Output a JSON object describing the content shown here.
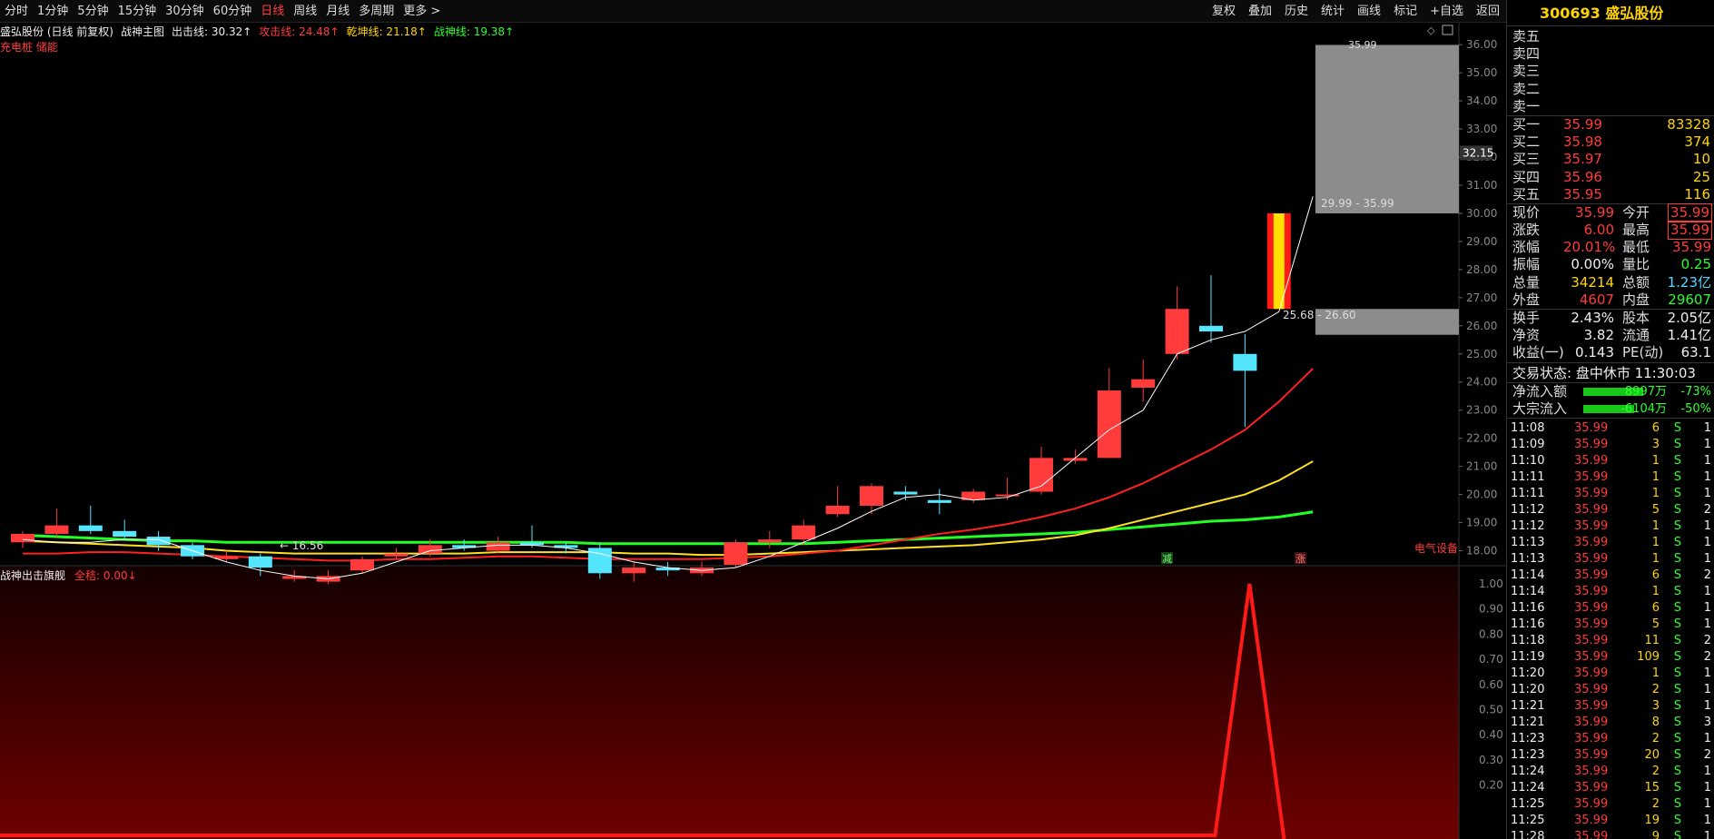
{
  "toolbar": {
    "periods": [
      "分时",
      "1分钟",
      "5分钟",
      "15分钟",
      "30分钟",
      "60分钟",
      "日线",
      "周线",
      "月线",
      "多周期",
      "更多 >"
    ],
    "active_period": "日线",
    "right_items": [
      "复权",
      "叠加",
      "历史",
      "统计",
      "画线",
      "标记",
      "+自选",
      "返回"
    ]
  },
  "legend": {
    "stock": "盛弘股份 (日线 前复权)",
    "indicator": "战神主图",
    "chuji": "出击线: 30.32↑",
    "gongji": "攻击线: 24.48↑",
    "qiankun": "乾坤线: 21.18↑",
    "zhanshen": "战神线: 19.38↑",
    "sub": "充电桩 储能"
  },
  "sub_legend": {
    "name": "战神出击旗舰",
    "value": "全秸: 0.00↓"
  },
  "colors": {
    "up": "#ff3b3b",
    "down": "#55e6ff",
    "ma_gongji": "#ff2020",
    "ma_qiankun": "#ffe020",
    "ma_zhanshen": "#22ff22",
    "price_line": "#ffffff"
  },
  "chart_data": {
    "type": "candlestick",
    "y_axis_ticks": [
      "36.00",
      "35.00",
      "34.00",
      "33.00",
      "32.00",
      "31.00",
      "30.00",
      "29.00",
      "28.00",
      "27.00",
      "26.00",
      "25.00",
      "24.00",
      "23.00",
      "22.00",
      "21.00",
      "20.00",
      "19.00",
      "18.00"
    ],
    "ylim": [
      17.5,
      36.2
    ],
    "current_price_marker": "32.15",
    "sub_axis_ticks": [
      "1.00",
      "0.90",
      "0.80",
      "0.70",
      "0.60",
      "0.50",
      "0.40",
      "0.30",
      "0.20"
    ],
    "candles": [
      {
        "o": 18.3,
        "c": 18.6,
        "h": 18.7,
        "l": 18.1
      },
      {
        "o": 18.6,
        "c": 18.9,
        "h": 19.5,
        "l": 18.5
      },
      {
        "o": 18.9,
        "c": 18.7,
        "h": 19.6,
        "l": 18.6
      },
      {
        "o": 18.7,
        "c": 18.5,
        "h": 19.1,
        "l": 18.4
      },
      {
        "o": 18.5,
        "c": 18.2,
        "h": 18.7,
        "l": 18.0
      },
      {
        "o": 18.2,
        "c": 17.8,
        "h": 18.3,
        "l": 17.7
      },
      {
        "o": 17.7,
        "c": 17.8,
        "h": 18.0,
        "l": 17.6
      },
      {
        "o": 17.8,
        "c": 17.4,
        "h": 17.9,
        "l": 17.1
      },
      {
        "o": 17.0,
        "c": 17.1,
        "h": 17.3,
        "l": 16.9
      },
      {
        "o": 16.9,
        "c": 17.1,
        "h": 17.3,
        "l": 16.8
      },
      {
        "o": 17.3,
        "c": 17.7,
        "h": 17.8,
        "l": 17.2
      },
      {
        "o": 17.8,
        "c": 17.9,
        "h": 18.1,
        "l": 17.7
      },
      {
        "o": 17.9,
        "c": 18.2,
        "h": 18.4,
        "l": 17.8
      },
      {
        "o": 18.2,
        "c": 18.1,
        "h": 18.4,
        "l": 18.0
      },
      {
        "o": 18.0,
        "c": 18.3,
        "h": 18.5,
        "l": 17.9
      },
      {
        "o": 18.3,
        "c": 18.2,
        "h": 18.9,
        "l": 18.1
      },
      {
        "o": 18.2,
        "c": 18.1,
        "h": 18.3,
        "l": 17.9
      },
      {
        "o": 18.1,
        "c": 17.2,
        "h": 18.3,
        "l": 17.0
      },
      {
        "o": 17.2,
        "c": 17.4,
        "h": 17.6,
        "l": 16.9
      },
      {
        "o": 17.4,
        "c": 17.3,
        "h": 17.6,
        "l": 17.1
      },
      {
        "o": 17.2,
        "c": 17.4,
        "h": 17.6,
        "l": 17.1
      },
      {
        "o": 17.5,
        "c": 18.3,
        "h": 18.4,
        "l": 17.4
      },
      {
        "o": 18.3,
        "c": 18.4,
        "h": 18.7,
        "l": 18.1
      },
      {
        "o": 18.4,
        "c": 18.9,
        "h": 19.1,
        "l": 18.2
      },
      {
        "o": 19.3,
        "c": 19.6,
        "h": 20.3,
        "l": 19.2
      },
      {
        "o": 19.6,
        "c": 20.3,
        "h": 20.4,
        "l": 19.3
      },
      {
        "o": 20.1,
        "c": 20.0,
        "h": 20.3,
        "l": 19.8
      },
      {
        "o": 19.8,
        "c": 19.7,
        "h": 20.2,
        "l": 19.3
      },
      {
        "o": 19.8,
        "c": 20.1,
        "h": 20.2,
        "l": 19.7
      },
      {
        "o": 20.0,
        "c": 20.0,
        "h": 20.6,
        "l": 19.8
      },
      {
        "o": 20.1,
        "c": 21.3,
        "h": 21.7,
        "l": 20.0
      },
      {
        "o": 21.2,
        "c": 21.3,
        "h": 21.6,
        "l": 21.1
      },
      {
        "o": 21.3,
        "c": 23.7,
        "h": 24.5,
        "l": 21.3
      },
      {
        "o": 23.8,
        "c": 24.1,
        "h": 24.8,
        "l": 23.3
      },
      {
        "o": 25.0,
        "c": 26.6,
        "h": 27.4,
        "l": 24.8
      },
      {
        "o": 26.0,
        "c": 25.8,
        "h": 27.8,
        "l": 25.4
      },
      {
        "o": 25.0,
        "c": 24.4,
        "h": 25.7,
        "l": 22.4
      },
      {
        "o": 26.6,
        "c": 30.0,
        "h": 30.0,
        "l": 26.6
      }
    ],
    "ma_gongji": [
      17.9,
      17.9,
      17.95,
      17.95,
      17.9,
      17.85,
      17.8,
      17.75,
      17.7,
      17.65,
      17.65,
      17.7,
      17.7,
      17.75,
      17.8,
      17.8,
      17.75,
      17.7,
      17.7,
      17.7,
      17.7,
      17.75,
      17.8,
      17.9,
      18.0,
      18.2,
      18.4,
      18.6,
      18.75,
      18.95,
      19.2,
      19.5,
      19.9,
      20.4,
      21.0,
      21.6,
      22.3,
      23.3,
      24.48
    ],
    "ma_qiankun": [
      18.35,
      18.3,
      18.25,
      18.2,
      18.15,
      18.1,
      18.0,
      17.95,
      17.9,
      17.9,
      17.9,
      17.9,
      17.9,
      17.9,
      17.95,
      17.95,
      17.95,
      17.95,
      17.9,
      17.9,
      17.85,
      17.85,
      17.9,
      17.95,
      18.0,
      18.05,
      18.1,
      18.15,
      18.2,
      18.3,
      18.4,
      18.55,
      18.8,
      19.1,
      19.4,
      19.7,
      20.0,
      20.5,
      21.18
    ],
    "ma_zhanshen": [
      18.55,
      18.5,
      18.45,
      18.4,
      18.35,
      18.35,
      18.3,
      18.3,
      18.3,
      18.3,
      18.3,
      18.3,
      18.3,
      18.3,
      18.3,
      18.3,
      18.3,
      18.25,
      18.25,
      18.25,
      18.25,
      18.25,
      18.25,
      18.25,
      18.3,
      18.35,
      18.4,
      18.45,
      18.5,
      18.55,
      18.6,
      18.65,
      18.75,
      18.85,
      18.95,
      19.05,
      19.1,
      19.2,
      19.38
    ],
    "price_line": [
      18.4,
      18.3,
      18.3,
      18.4,
      18.4,
      18.0,
      17.6,
      17.3,
      17.1,
      17.0,
      17.2,
      17.6,
      18.0,
      18.1,
      18.2,
      18.2,
      18.1,
      17.9,
      17.6,
      17.4,
      17.3,
      17.4,
      17.8,
      18.3,
      18.8,
      19.4,
      19.9,
      20.0,
      19.8,
      19.9,
      20.3,
      21.3,
      22.3,
      23.0,
      25.0,
      25.5,
      25.8,
      26.5,
      30.6
    ],
    "annotations": {
      "low": "16.56",
      "zone_top": "29.99 - 35.99",
      "zone_bottom": "25.68 - 26.60",
      "high": "35.99",
      "sector": "电气设备",
      "tag_jian": "减",
      "tag_zhang": "涨"
    }
  },
  "quote": {
    "code": "300693",
    "name": "盛弘股份",
    "sell": [
      {
        "label": "卖五",
        "price": "",
        "vol": ""
      },
      {
        "label": "卖四",
        "price": "",
        "vol": ""
      },
      {
        "label": "卖三",
        "price": "",
        "vol": ""
      },
      {
        "label": "卖二",
        "price": "",
        "vol": ""
      },
      {
        "label": "卖一",
        "price": "",
        "vol": ""
      }
    ],
    "buy": [
      {
        "label": "买一",
        "price": "35.99",
        "vol": "83328"
      },
      {
        "label": "买二",
        "price": "35.98",
        "vol": "374"
      },
      {
        "label": "买三",
        "price": "35.97",
        "vol": "10"
      },
      {
        "label": "买四",
        "price": "35.96",
        "vol": "25"
      },
      {
        "label": "买五",
        "price": "35.95",
        "vol": "116"
      }
    ],
    "stats1": [
      {
        "l1": "现价",
        "v1": "35.99",
        "c1": "red",
        "l2": "今开",
        "v2": "35.99",
        "c2": "red",
        "b2": true
      },
      {
        "l1": "涨跌",
        "v1": "6.00",
        "c1": "red",
        "l2": "最高",
        "v2": "35.99",
        "c2": "red",
        "b2": true
      },
      {
        "l1": "涨幅",
        "v1": "20.01%",
        "c1": "red",
        "l2": "最低",
        "v2": "35.99",
        "c2": "red",
        "b2": false
      },
      {
        "l1": "振幅",
        "v1": "0.00%",
        "c1": "white",
        "l2": "量比",
        "v2": "0.25",
        "c2": "green",
        "b2": false
      },
      {
        "l1": "总量",
        "v1": "34214",
        "c1": "yellow",
        "l2": "总额",
        "v2": "1.23亿",
        "c2": "cyan",
        "b2": false
      },
      {
        "l1": "外盘",
        "v1": "4607",
        "c1": "red",
        "l2": "内盘",
        "v2": "29607",
        "c2": "green",
        "b2": false
      }
    ],
    "stats2": [
      {
        "l1": "换手",
        "v1": "2.43%",
        "l2": "股本",
        "v2": "2.05亿"
      },
      {
        "l1": "净资",
        "v1": "3.82",
        "l2": "流通",
        "v2": "1.41亿"
      },
      {
        "l1": "收益(一)",
        "v1": "0.143",
        "l2": "PE(动)",
        "v2": "63.1"
      }
    ],
    "status": "交易状态: 盘中休市 11:30:03",
    "flows": [
      {
        "label": "净流入额",
        "value": "8997万",
        "pct": "-73%"
      },
      {
        "label": "大宗流入",
        "value": "-6104万",
        "pct": "-50%"
      }
    ],
    "ticks": [
      [
        "11:08",
        "35.99",
        "6",
        "S",
        "1"
      ],
      [
        "11:09",
        "35.99",
        "3",
        "S",
        "1"
      ],
      [
        "11:10",
        "35.99",
        "1",
        "S",
        "1"
      ],
      [
        "11:11",
        "35.99",
        "1",
        "S",
        "1"
      ],
      [
        "11:11",
        "35.99",
        "1",
        "S",
        "1"
      ],
      [
        "11:12",
        "35.99",
        "5",
        "S",
        "2"
      ],
      [
        "11:12",
        "35.99",
        "1",
        "S",
        "1"
      ],
      [
        "11:13",
        "35.99",
        "1",
        "S",
        "1"
      ],
      [
        "11:13",
        "35.99",
        "1",
        "S",
        "1"
      ],
      [
        "11:14",
        "35.99",
        "6",
        "S",
        "2"
      ],
      [
        "11:14",
        "35.99",
        "1",
        "S",
        "1"
      ],
      [
        "11:16",
        "35.99",
        "6",
        "S",
        "1"
      ],
      [
        "11:16",
        "35.99",
        "5",
        "S",
        "1"
      ],
      [
        "11:18",
        "35.99",
        "11",
        "S",
        "2"
      ],
      [
        "11:19",
        "35.99",
        "109",
        "S",
        "2"
      ],
      [
        "11:20",
        "35.99",
        "1",
        "S",
        "1"
      ],
      [
        "11:20",
        "35.99",
        "2",
        "S",
        "1"
      ],
      [
        "11:21",
        "35.99",
        "3",
        "S",
        "1"
      ],
      [
        "11:21",
        "35.99",
        "8",
        "S",
        "3"
      ],
      [
        "11:23",
        "35.99",
        "2",
        "S",
        "1"
      ],
      [
        "11:23",
        "35.99",
        "20",
        "S",
        "2"
      ],
      [
        "11:24",
        "35.99",
        "2",
        "S",
        "1"
      ],
      [
        "11:24",
        "35.99",
        "15",
        "S",
        "1"
      ],
      [
        "11:25",
        "35.99",
        "2",
        "S",
        "1"
      ],
      [
        "11:25",
        "35.99",
        "19",
        "S",
        "1"
      ],
      [
        "11:28",
        "35.99",
        "9",
        "S",
        "1"
      ]
    ]
  }
}
